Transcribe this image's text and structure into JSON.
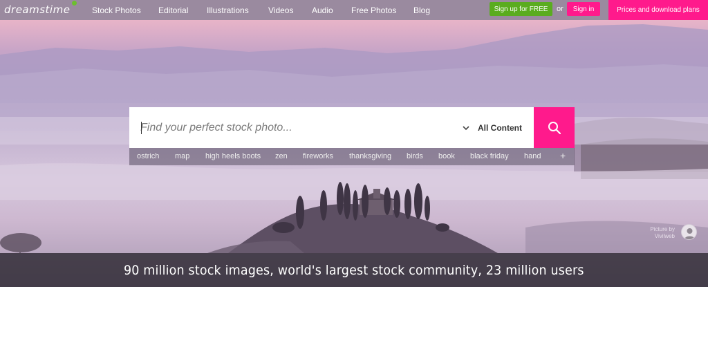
{
  "brand": {
    "logo_text": "dreamstime",
    "logo_mark": "®",
    "accent_green": "#5aac1f",
    "accent_pink": "#ff1a8c"
  },
  "nav": {
    "items": [
      {
        "label": "Stock Photos"
      },
      {
        "label": "Editorial"
      },
      {
        "label": "Illustrations"
      },
      {
        "label": "Videos"
      },
      {
        "label": "Audio"
      },
      {
        "label": "Free Photos"
      },
      {
        "label": "Blog"
      }
    ],
    "signup_label": "Sign up for FREE",
    "or_label": "or",
    "signin_label": "Sign in",
    "prices_label": "Prices and download plans"
  },
  "search": {
    "placeholder": "Find your perfect stock photo...",
    "value": "",
    "content_filter": "All Content",
    "button_icon": "search-icon"
  },
  "suggestions": [
    "ostrich",
    "map",
    "high heels boots",
    "zen",
    "fireworks",
    "thanksgiving",
    "birds",
    "book",
    "black friday",
    "hand"
  ],
  "suggestions_more": "+",
  "credit": {
    "line1": "Picture by",
    "line2": "Vivilweb"
  },
  "tagline": "90 million stock images, world's largest stock community, 23 million users"
}
